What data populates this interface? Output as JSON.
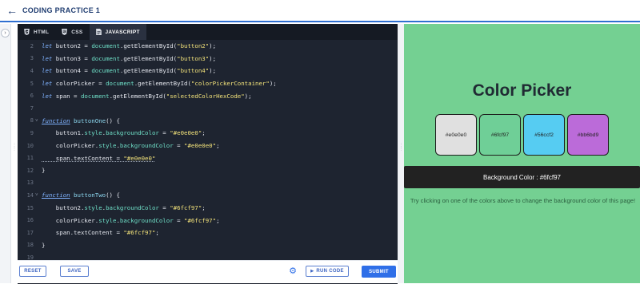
{
  "header": {
    "title": "CODING PRACTICE 1"
  },
  "tabs": [
    {
      "label": "HTML",
      "icon": "html5-icon"
    },
    {
      "label": "CSS",
      "icon": "css3-icon"
    },
    {
      "label": "JAVASCRIPT",
      "icon": "js-file-icon"
    }
  ],
  "code": {
    "line_numbers": [
      "2",
      "3",
      "4",
      "5",
      "6",
      "7",
      "8",
      "9",
      "10",
      "11",
      "12",
      "13",
      "14",
      "15",
      "16",
      "17",
      "18",
      "19"
    ],
    "lines": {
      "l2": {
        "kw": "let",
        "rest1": " button2 = ",
        "obj": "document",
        "rest2": ".getElementById(",
        "str": "\"button2\"",
        "rest3": ");"
      },
      "l3": {
        "kw": "let",
        "rest1": " button3 = ",
        "obj": "document",
        "rest2": ".getElementById(",
        "str": "\"button3\"",
        "rest3": ");"
      },
      "l4": {
        "kw": "let",
        "rest1": " button4 = ",
        "obj": "document",
        "rest2": ".getElementById(",
        "str": "\"button4\"",
        "rest3": ");"
      },
      "l5": {
        "kw": "let",
        "rest1": " colorPicker = ",
        "obj": "document",
        "rest2": ".getElementById(",
        "str": "\"colorPickerContainer\"",
        "rest3": ");"
      },
      "l6": {
        "kw": "let",
        "rest1": " span = ",
        "obj": "document",
        "rest2": ".getElementById(",
        "str": "\"selectedColorHexCode\"",
        "rest3": ");"
      },
      "l8": {
        "kw": "function",
        "fname": " buttonOne",
        "rest": "() {"
      },
      "l9": {
        "a": "    button1.",
        "b": "style",
        "c": ".",
        "d": "backgroundColor",
        "e": " = ",
        "str": "\"#e0e0e0\"",
        "end": ";"
      },
      "l10": {
        "a": "    colorPicker.",
        "b": "style",
        "c": ".",
        "d": "backgroundColor",
        "e": " = ",
        "str": "\"#e0e0e0\"",
        "end": ";"
      },
      "l11": {
        "a": "    span.textContent = ",
        "str": "\"#e0e0e0\""
      },
      "l12": {
        "txt": "}"
      },
      "l14": {
        "kw": "function",
        "fname": " buttonTwo",
        "rest": "() {"
      },
      "l15": {
        "a": "    button2.",
        "b": "style",
        "c": ".",
        "d": "backgroundColor",
        "e": " = ",
        "str": "\"#6fcf97\"",
        "end": ";"
      },
      "l16": {
        "a": "    colorPicker.",
        "b": "style",
        "c": ".",
        "d": "backgroundColor",
        "e": " = ",
        "str": "\"#6fcf97\"",
        "end": ";"
      },
      "l17": {
        "a": "    span.textContent = ",
        "str": "\"#6fcf97\"",
        "end": ";"
      },
      "l18": {
        "txt": "}"
      }
    }
  },
  "toolbar": {
    "reset_label": "RESET",
    "save_label": "SAVE",
    "run_label": "RUN CODE",
    "submit_label": "SUBMIT"
  },
  "preview": {
    "title": "Color Picker",
    "swatches": [
      {
        "label": "#e0e0e0",
        "color": "#e0e0e0"
      },
      {
        "label": "#6fcf97",
        "color": "#6fcf97"
      },
      {
        "label": "#56ccf2",
        "color": "#56ccf2"
      },
      {
        "label": "#bb6bd9",
        "color": "#bb6bd9"
      }
    ],
    "background_color": "#6fcf97",
    "result_prefix": "Background Color : ",
    "result_value": "#6fcf97",
    "hint": "Try clicking on one of the colors above to change the background color of this page!"
  },
  "colors": {
    "accent": "#2f6fe8",
    "editor_bg": "#1e2430",
    "string": "#f2e27a",
    "keyword": "#7fb2ff"
  }
}
